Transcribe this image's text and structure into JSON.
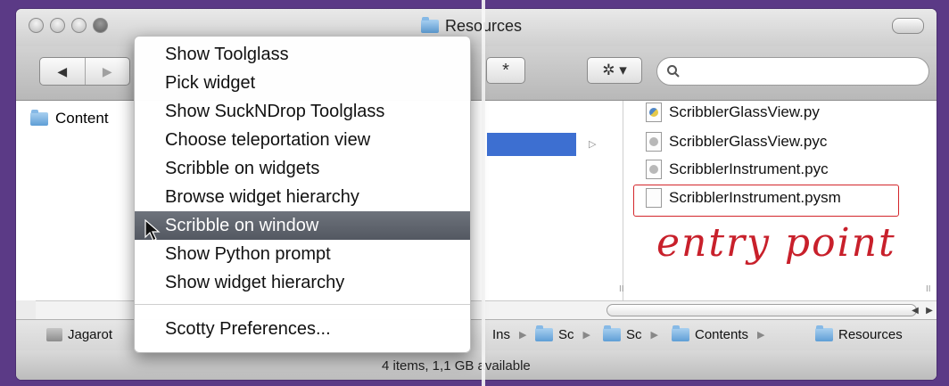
{
  "window": {
    "title": "Resources",
    "status": "4 items, 1,1   GB available"
  },
  "toolbar": {
    "back_icon": "◀",
    "forward_icon": "▶",
    "star_label": "*",
    "gear_label": "✲ ▾",
    "search_placeholder": ""
  },
  "sidebar": {
    "item_label": "Content"
  },
  "files": [
    {
      "name": "ScribblerGlassView.py",
      "kind": "py"
    },
    {
      "name": "ScribblerGlassView.pyc",
      "kind": "pyc"
    },
    {
      "name": "ScribblerInstrument.pyc",
      "kind": "pyc"
    },
    {
      "name": "ScribblerInstrument.pysm",
      "kind": "doc"
    }
  ],
  "annotation": {
    "handwritten": "entry point",
    "color": "#c8202b"
  },
  "pathbar": {
    "items": [
      "Jagarot",
      "Ins",
      "Sc",
      "Sc",
      "Contents",
      "Resources"
    ]
  },
  "menu": {
    "items": [
      "Show Toolglass",
      "Pick widget",
      "Show SuckNDrop Toolglass",
      "Choose teleportation view",
      "Scribble on widgets",
      "Browse widget hierarchy",
      "Scribble on window",
      "Show Python prompt",
      "Show widget hierarchy"
    ],
    "highlighted_index": 6,
    "preferences": "Scotty Preferences..."
  },
  "colors": {
    "background": "#5b3a86",
    "highlight": "#5d626b"
  }
}
